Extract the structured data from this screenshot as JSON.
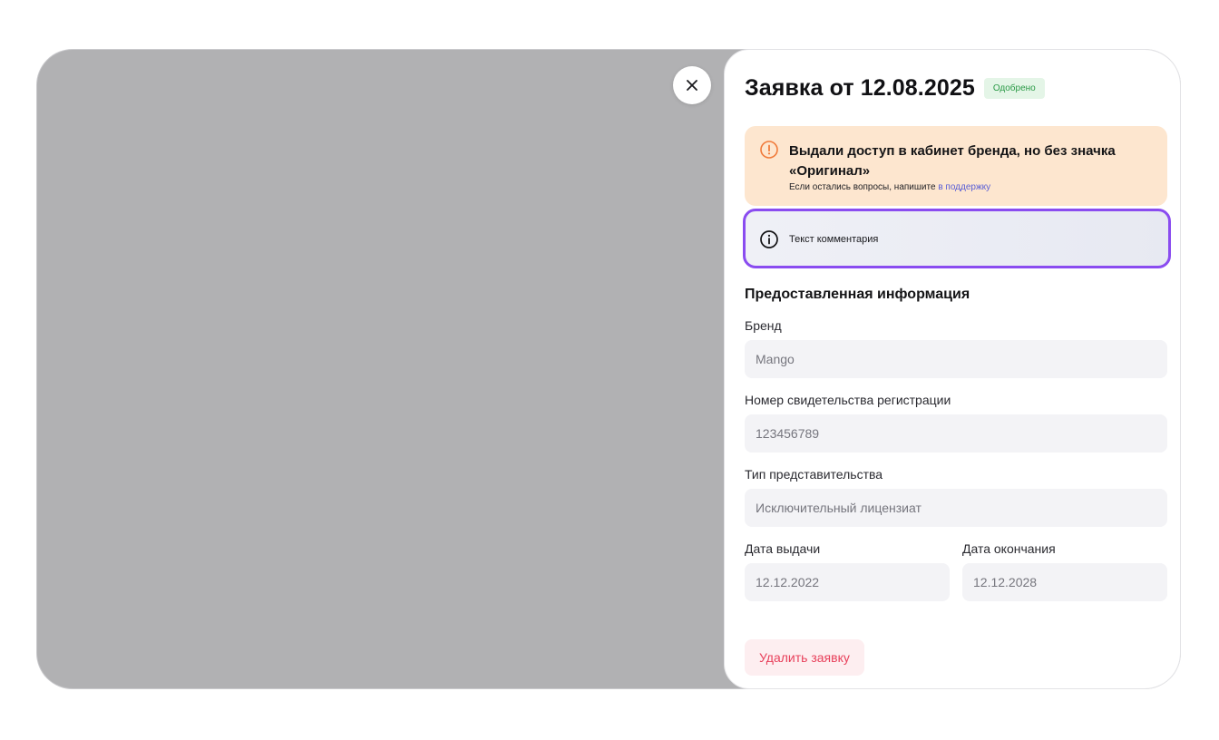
{
  "modal": {
    "title": "Заявка от 12.08.2025",
    "status": "Одобрено",
    "close_icon": "close-icon",
    "warning": {
      "icon": "alert-circle-icon",
      "title": "Выдали доступ в кабинет бренда, но без значка «Оригинал»",
      "subtitle": "Если остались вопросы, напишите",
      "link": "в поддержку"
    },
    "comment": {
      "icon": "info-circle-icon",
      "text": "Текст комментария"
    },
    "section_title": "Предоставленная информация",
    "fields": {
      "brand": {
        "label": "Бренд",
        "value": "Mango"
      },
      "certificate": {
        "label": "Номер свидетельства регистрации",
        "value": "123456789"
      },
      "representation": {
        "label": "Тип представительства",
        "value": "Исключительный лицензиат"
      },
      "issue_date": {
        "label": "Дата выдачи",
        "value": "12.12.2022"
      },
      "end_date": {
        "label": "Дата окончания",
        "value": "12.12.2028"
      }
    },
    "delete_label": "Удалить заявку"
  },
  "colors": {
    "overlay": "#b1b1b3",
    "approved_bg": "#e4f5e7",
    "approved_text": "#2b9a47",
    "warning_bg": "#fde6cf",
    "warning_icon": "#f07a3a",
    "comment_border": "#8a4cf0",
    "link": "#5a5fd6",
    "delete_text": "#e8405b"
  }
}
